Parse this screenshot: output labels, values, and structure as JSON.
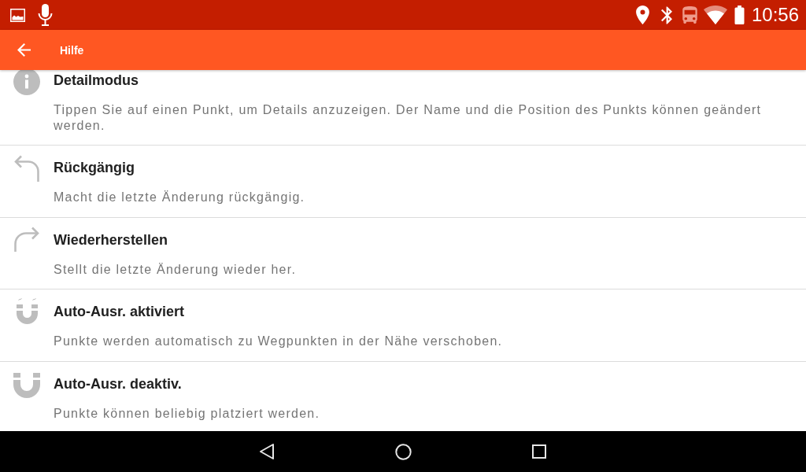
{
  "status_bar": {
    "time": "10:56"
  },
  "app_bar": {
    "title": "Hilfe"
  },
  "help_items": [
    {
      "kind": "info",
      "title": "Detailmodus",
      "description": "Tippen Sie auf einen Punkt, um Details anzuzeigen. Der Name und die Position des Punkts können geändert werden."
    },
    {
      "kind": "undo",
      "title": "Rückgängig",
      "description": "Macht die letzte Änderung rückgängig."
    },
    {
      "kind": "redo",
      "title": "Wiederherstellen",
      "description": "Stellt die letzte Änderung wieder her."
    },
    {
      "kind": "magnet-on",
      "title": "Auto-Ausr. aktiviert",
      "description": "Punkte werden automatisch zu Wegpunkten in der Nähe verschoben."
    },
    {
      "kind": "magnet-off",
      "title": "Auto-Ausr. deaktiv.",
      "description": "Punkte können beliebig platziert werden."
    }
  ]
}
